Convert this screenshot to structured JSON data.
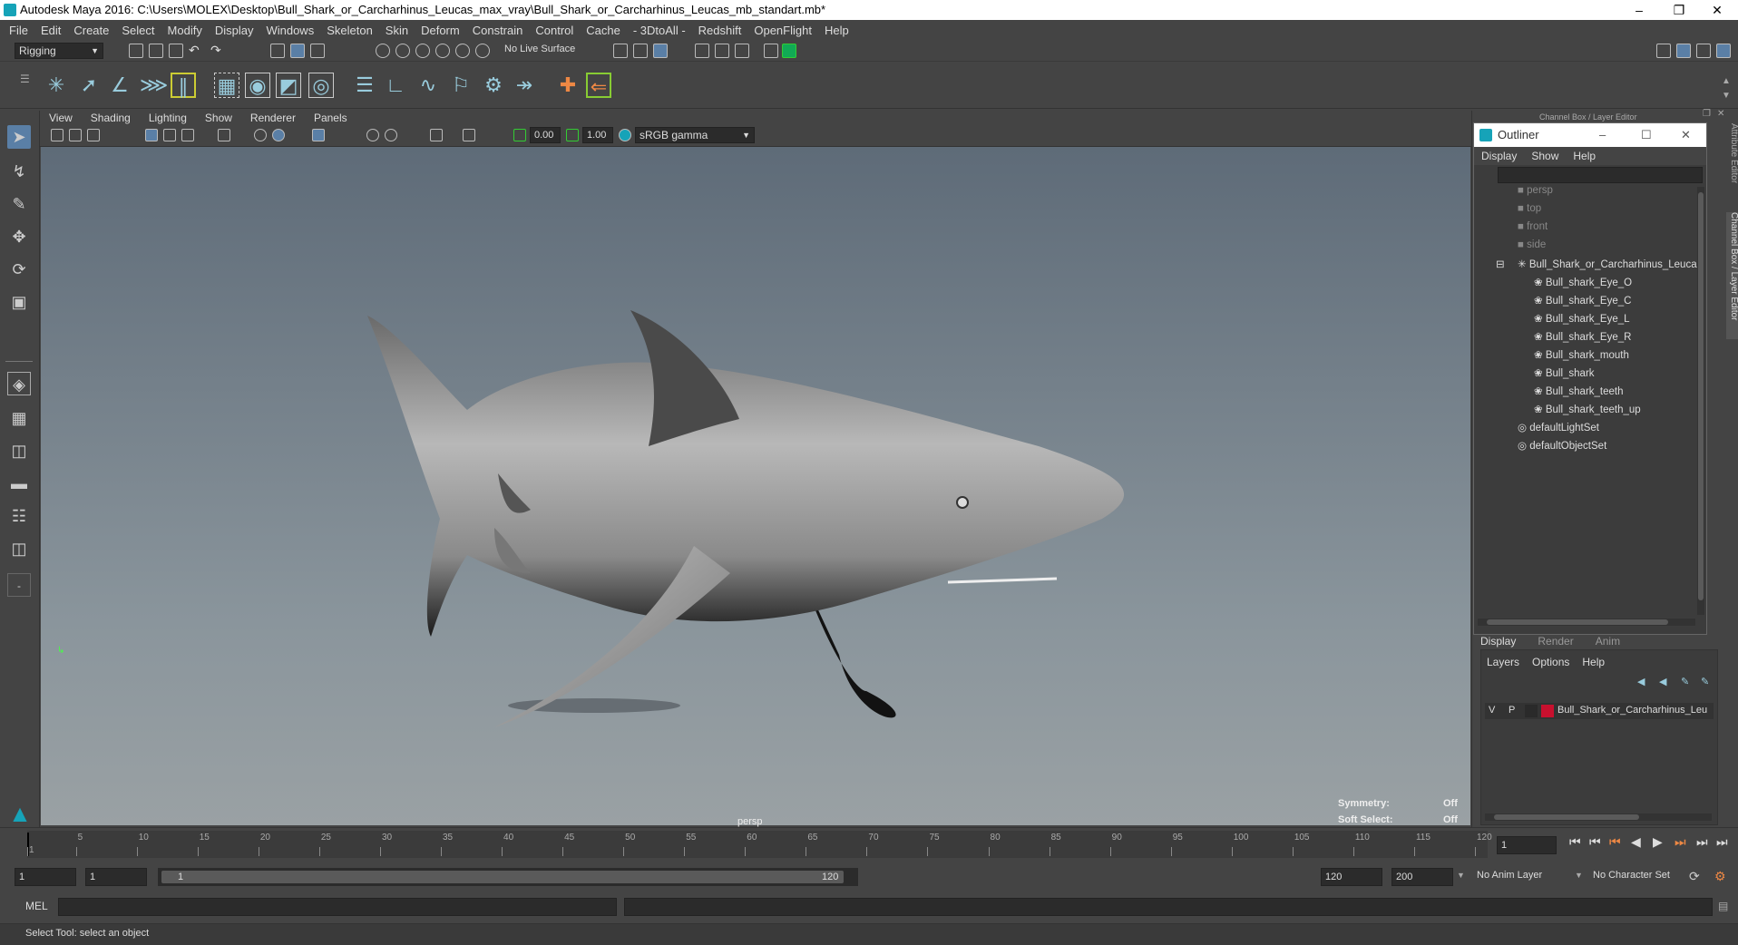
{
  "window": {
    "title": "Autodesk Maya 2016: C:\\Users\\MOLEX\\Desktop\\Bull_Shark_or_Carcharhinus_Leucas_max_vray\\Bull_Shark_or_Carcharhinus_Leucas_mb_standart.mb*"
  },
  "menubar": [
    "File",
    "Edit",
    "Create",
    "Select",
    "Modify",
    "Display",
    "Windows",
    "Skeleton",
    "Skin",
    "Deform",
    "Constrain",
    "Control",
    "Cache",
    "- 3DtoAll -",
    "Redshift",
    "OpenFlight",
    "Help"
  ],
  "status_line": {
    "mode": "Rigging",
    "live_surface": "No Live Surface"
  },
  "panel_menu": [
    "View",
    "Shading",
    "Lighting",
    "Show",
    "Renderer",
    "Panels"
  ],
  "viewport_toolbar": {
    "exposure": "0.00",
    "gamma": "1.00",
    "color_space": "sRGB gamma"
  },
  "viewport": {
    "camera_label": "persp",
    "symmetry_label": "Symmetry:",
    "symmetry_value": "Off",
    "soft_select_label": "Soft Select:",
    "soft_select_value": "Off"
  },
  "channel_box": {
    "header": "Channel Box / Layer Editor",
    "side_tabs": [
      "Attribute Editor",
      "Channel Box / Layer Editor"
    ]
  },
  "outliner": {
    "title": "Outliner",
    "menu": [
      "Display",
      "Show",
      "Help"
    ],
    "items": [
      {
        "label": "persp",
        "type": "camera"
      },
      {
        "label": "top",
        "type": "camera"
      },
      {
        "label": "front",
        "type": "camera"
      },
      {
        "label": "side",
        "type": "camera"
      },
      {
        "label": "Bull_Shark_or_Carcharhinus_Leucas",
        "type": "group"
      },
      {
        "label": "Bull_shark_Eye_O",
        "type": "mesh"
      },
      {
        "label": "Bull_shark_Eye_C",
        "type": "mesh"
      },
      {
        "label": "Bull_shark_Eye_L",
        "type": "mesh"
      },
      {
        "label": "Bull_shark_Eye_R",
        "type": "mesh"
      },
      {
        "label": "Bull_shark_mouth",
        "type": "mesh"
      },
      {
        "label": "Bull_shark",
        "type": "mesh"
      },
      {
        "label": "Bull_shark_teeth",
        "type": "mesh"
      },
      {
        "label": "Bull_shark_teeth_up",
        "type": "mesh"
      },
      {
        "label": "defaultLightSet",
        "type": "set"
      },
      {
        "label": "defaultObjectSet",
        "type": "set"
      }
    ]
  },
  "layer_editor": {
    "tabs": [
      "Display",
      "Render",
      "Anim"
    ],
    "menu": [
      "Layers",
      "Options",
      "Help"
    ],
    "layer": {
      "v": "V",
      "p": "P",
      "name": "Bull_Shark_or_Carcharhinus_Leu",
      "color": "#c8102e"
    }
  },
  "timeline": {
    "ticks": [
      "1",
      "5",
      "10",
      "15",
      "20",
      "25",
      "30",
      "35",
      "40",
      "45",
      "50",
      "55",
      "60",
      "65",
      "70",
      "75",
      "80",
      "85",
      "90",
      "95",
      "100",
      "105",
      "110",
      "115",
      "120"
    ],
    "current_frame": "1"
  },
  "range": {
    "start": "1",
    "playback_start": "1",
    "slider_start": "1",
    "slider_end": "120",
    "playback_end": "120",
    "end": "200",
    "anim_layer": "No Anim Layer",
    "character_set": "No Character Set"
  },
  "command_line": {
    "label": "MEL"
  },
  "status_bar": {
    "help": "Select Tool: select an object"
  },
  "colors": {
    "ui_bg": "#444444",
    "accent": "#16a3b8",
    "layer_color": "#c8102e"
  }
}
